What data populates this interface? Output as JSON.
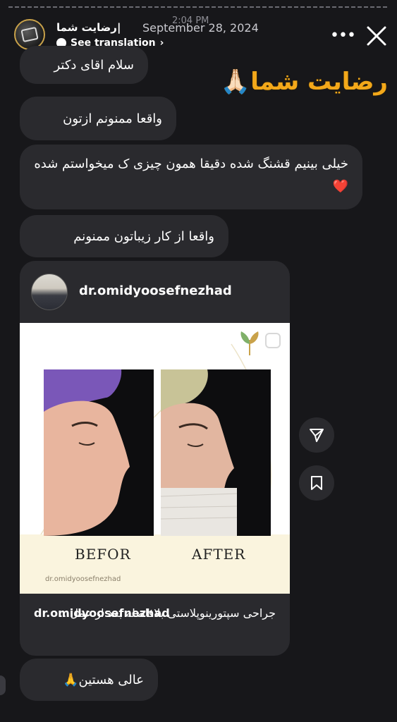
{
  "header": {
    "time": "2:04 PM",
    "user_name": "رضایت شما|",
    "date": "September 28, 2024",
    "translate_label": "See translation",
    "more_glyph": "•••"
  },
  "sticker_text": "رضایت شما🙏🏻",
  "messages": [
    "سلام اقای دکتر",
    "واقعا ممنونم ازتون",
    "خیلی بینیم قشنگ شده دقیقا همون چیزی ک میخواستم شده❤️",
    "واقعا از کار زیباتون ممنونم"
  ],
  "shared_post": {
    "username": "dr.omidyoosefnezhad",
    "before_label": "BEFOR",
    "after_label": "AFTER",
    "watermark": "dr.omidyoosefnezhad",
    "caption_user": "dr.omidyoosefnezhad",
    "caption_text": "جراحی سپتورینوپلاستی بلافاصله بعد از عمل..."
  },
  "last_message": "عالی هستین🙏",
  "colors": {
    "background": "#17171a",
    "bubble": "#2a2a2e",
    "sticker": "#f3a81a"
  },
  "icons": [
    "close-icon",
    "more-icon",
    "translate-icon",
    "share-icon",
    "bookmark-icon"
  ]
}
